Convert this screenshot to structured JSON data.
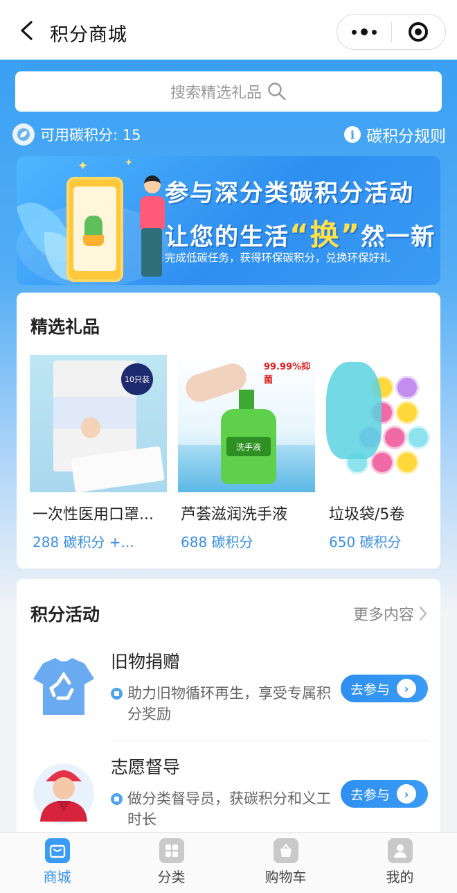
{
  "nav": {
    "title": "积分商城"
  },
  "search": {
    "placeholder": "搜索精选礼品"
  },
  "points": {
    "label": "可用碳积分: 15",
    "rules_label": "碳积分规则",
    "info_glyph": "i"
  },
  "banner": {
    "line1": "参与深分类碳积分活动",
    "line2_a": "让您的生活",
    "line2_hl": "“换”",
    "line2_b": "然一新",
    "subtitle": "完成低碳任务，获得环保碳积分，兑换环保好礼"
  },
  "gifts": {
    "title": "精选礼品",
    "items": [
      {
        "name": "一次性医用口罩...",
        "price": "288 碳积分 +...",
        "icon": "mask-pack-image"
      },
      {
        "name": "芦荟滋润洗手液",
        "price": "688 碳积分",
        "icon": "handwash-image"
      },
      {
        "name": "垃圾袋/5卷",
        "price": "650 碳积分",
        "icon": "trash-bags-image"
      }
    ],
    "mask_badge": "10只装",
    "wash_badge": "99.99%抑菌",
    "wash_label": "洗手液"
  },
  "activities": {
    "title": "积分活动",
    "more_label": "更多内容",
    "items": [
      {
        "title": "旧物捐赠",
        "desc": "助力旧物循环再生，享受专属积分奖励",
        "button": "去参与",
        "icon": "recycle-shirt-icon"
      },
      {
        "title": "志愿督导",
        "desc": "做分类督导员，获碳积分和义工时长",
        "button": "去参与",
        "icon": "volunteer-icon"
      }
    ]
  },
  "tabbar": {
    "items": [
      {
        "label": "商城",
        "icon": "shop-icon",
        "active": true
      },
      {
        "label": "分类",
        "icon": "category-icon",
        "active": false
      },
      {
        "label": "购物车",
        "icon": "cart-icon",
        "active": false
      },
      {
        "label": "我的",
        "icon": "profile-icon",
        "active": false
      }
    ]
  },
  "colors": {
    "accent": "#3a9bf5",
    "price": "#3a8ee6",
    "header_bg": "#3aa0f3"
  }
}
